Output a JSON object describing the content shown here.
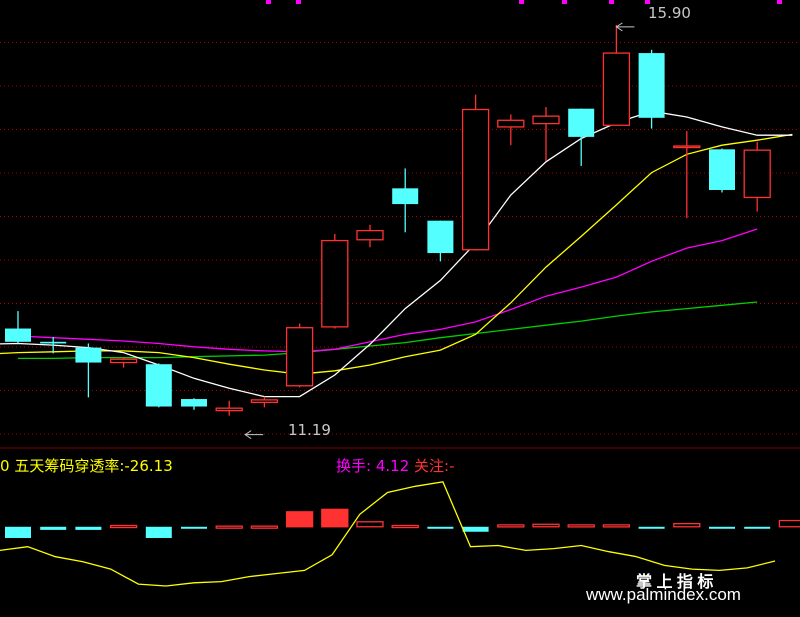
{
  "indicator": {
    "prefix": "0",
    "name": "五天筹码穿透率",
    "value_text": ":-26.13",
    "turnover_label": "换手",
    "turnover_value": ": 4.12",
    "attention_label": "关注",
    "attention_value": ":-"
  },
  "annotations": {
    "high_label": "15.90",
    "low_label": "11.19"
  },
  "watermark": {
    "cn": "掌 上 指 标",
    "url": "www.palmindex.com"
  },
  "colors": {
    "background": "#000000",
    "up_candle": "#ff3232",
    "down_candle": "#54ffff",
    "ma5": "#ffffff",
    "ma10": "#ffff00",
    "ma20": "#ff00ff",
    "ma60": "#00d000",
    "grid": "#b00000",
    "sub_line": "#ffff00",
    "turnover_text": "#ff00ff",
    "attention_text": "#ff3232"
  },
  "chart_data": {
    "type": "candlestick",
    "price_ylim": [
      10.8,
      16.2
    ],
    "candles": [
      {
        "o": 12.24,
        "h": 12.45,
        "l": 12.06,
        "c": 12.08
      },
      {
        "o": 12.08,
        "h": 12.14,
        "l": 11.94,
        "c": 12.06
      },
      {
        "o": 12.01,
        "h": 12.06,
        "l": 11.41,
        "c": 11.83
      },
      {
        "o": 11.83,
        "h": 11.9,
        "l": 11.77,
        "c": 11.87
      },
      {
        "o": 11.81,
        "h": 11.82,
        "l": 11.29,
        "c": 11.3
      },
      {
        "o": 11.39,
        "h": 11.4,
        "l": 11.26,
        "c": 11.3
      },
      {
        "o": 11.25,
        "h": 11.37,
        "l": 11.19,
        "c": 11.28
      },
      {
        "o": 11.35,
        "h": 11.42,
        "l": 11.29,
        "c": 11.38
      },
      {
        "o": 11.55,
        "h": 12.3,
        "l": 11.53,
        "c": 12.25
      },
      {
        "o": 12.26,
        "h": 13.38,
        "l": 12.24,
        "c": 13.3
      },
      {
        "o": 13.31,
        "h": 13.49,
        "l": 13.22,
        "c": 13.42
      },
      {
        "o": 13.93,
        "h": 14.17,
        "l": 13.4,
        "c": 13.74
      },
      {
        "o": 13.54,
        "h": 13.54,
        "l": 13.05,
        "c": 13.15
      },
      {
        "o": 13.19,
        "h": 15.06,
        "l": 13.18,
        "c": 14.88
      },
      {
        "o": 14.67,
        "h": 14.82,
        "l": 14.45,
        "c": 14.75
      },
      {
        "o": 14.71,
        "h": 14.91,
        "l": 14.26,
        "c": 14.8
      },
      {
        "o": 14.89,
        "h": 14.89,
        "l": 14.2,
        "c": 14.55
      },
      {
        "o": 14.69,
        "h": 15.9,
        "l": 14.69,
        "c": 15.56
      },
      {
        "o": 15.56,
        "h": 15.6,
        "l": 14.65,
        "c": 14.78
      },
      {
        "o": 14.44,
        "h": 14.62,
        "l": 13.57,
        "c": 14.44
      },
      {
        "o": 14.4,
        "h": 14.41,
        "l": 13.88,
        "c": 13.91
      },
      {
        "o": 13.82,
        "h": 14.49,
        "l": 13.65,
        "c": 14.39
      }
    ],
    "ma5": [
      12.05,
      12.06,
      12.04,
      12.01,
      11.95,
      11.8,
      11.64,
      11.52,
      11.42,
      11.42,
      11.68,
      12.05,
      12.48,
      12.82,
      13.27,
      13.85,
      14.25,
      14.53,
      14.72,
      14.86,
      14.79,
      14.67,
      14.57,
      14.57
    ],
    "ma10": [
      11.93,
      11.95,
      11.96,
      11.97,
      11.97,
      11.95,
      11.89,
      11.81,
      11.74,
      11.69,
      11.73,
      11.8,
      11.9,
      11.98,
      12.17,
      12.55,
      12.98,
      13.35,
      13.73,
      14.12,
      14.34,
      14.45,
      14.51,
      14.58
    ],
    "ma20": [
      12.15,
      12.13,
      12.11,
      12.09,
      12.06,
      12.02,
      11.99,
      11.97,
      11.96,
      11.99,
      12.08,
      12.17,
      12.23,
      12.32,
      12.47,
      12.63,
      12.74,
      12.86,
      13.05,
      13.21,
      13.3,
      13.44
    ],
    "ma60": [
      11.88,
      11.88,
      11.89,
      11.89,
      11.89,
      11.9,
      11.91,
      11.92,
      11.95,
      11.99,
      12.03,
      12.07,
      12.13,
      12.18,
      12.23,
      12.28,
      12.33,
      12.39,
      12.44,
      12.48,
      12.52,
      12.56
    ],
    "sub_ylim": [
      -140,
      120
    ],
    "sub_line": [
      -38,
      -32,
      -48,
      -56,
      -68,
      -92,
      -95,
      -90,
      -88,
      -80,
      -75,
      -70,
      -45,
      20,
      55,
      65,
      72,
      -32,
      -30,
      -38,
      -35,
      -30,
      -40,
      -48,
      -62,
      -68,
      -70,
      -66,
      -55
    ],
    "sub_bars": [
      {
        "type": "down",
        "v": -18
      },
      {
        "type": "down",
        "v": -5
      },
      {
        "type": "down",
        "v": -5
      },
      {
        "type": "up",
        "v": 2
      },
      {
        "type": "down",
        "v": -18
      },
      {
        "type": "down",
        "v": -2
      },
      {
        "type": "up",
        "v": 1
      },
      {
        "type": "up",
        "v": 1
      },
      {
        "type": "up",
        "v": 24
      },
      {
        "type": "up",
        "v": 28
      },
      {
        "type": "up",
        "v": 8
      },
      {
        "type": "up",
        "v": 2
      },
      {
        "type": "down",
        "v": -2
      },
      {
        "type": "down",
        "v": -8
      },
      {
        "type": "up",
        "v": 3
      },
      {
        "type": "up",
        "v": 4
      },
      {
        "type": "up",
        "v": 3
      },
      {
        "type": "up",
        "v": 3
      },
      {
        "type": "down",
        "v": -2
      },
      {
        "type": "up",
        "v": 5
      },
      {
        "type": "down",
        "v": -2
      },
      {
        "type": "down",
        "v": -3
      },
      {
        "type": "up",
        "v": 10
      }
    ]
  }
}
